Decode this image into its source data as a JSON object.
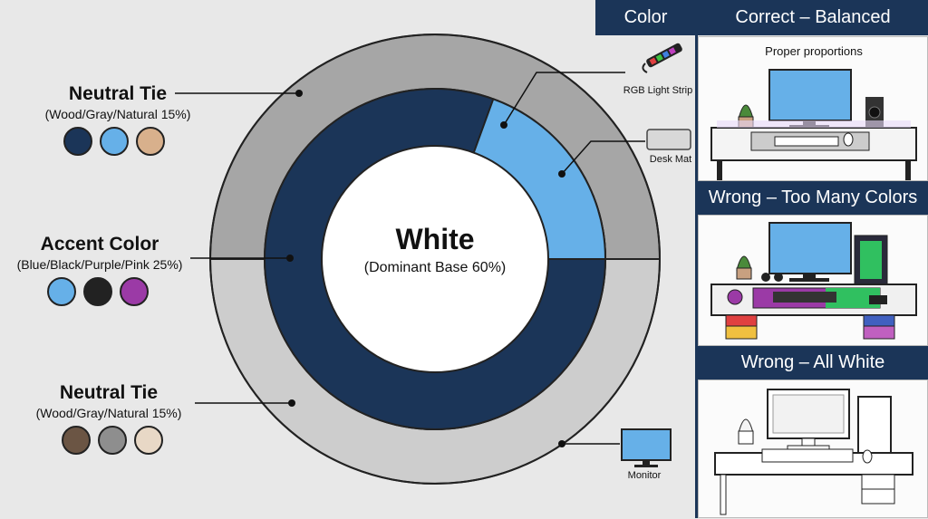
{
  "donut": {
    "center_title": "White",
    "center_subtitle": "(Dominant Base 60%)"
  },
  "labels": {
    "neutral_top": {
      "title": "Neutral Tie",
      "subtitle": "(Wood/Gray/Natural 15%)"
    },
    "accent": {
      "title": "Accent Color",
      "subtitle": "(Blue/Black/Purple/Pink 25%)"
    },
    "neutral_bottom": {
      "title": "Neutral Tie",
      "subtitle": "(Wood/Gray/Natural 15%)"
    }
  },
  "swatches": {
    "neutral_top": [
      "#1b3558",
      "#66b0e8",
      "#d8b08c"
    ],
    "accent": [
      "#66b0e8",
      "#222222",
      "#9b3aa6"
    ],
    "neutral_bottom": [
      "#6b5544",
      "#8e8e8e",
      "#e8d8c6"
    ]
  },
  "callouts": {
    "rgb_strip": "RGB Light Strip",
    "desk_mat": "Desk Mat",
    "monitor": "Monitor"
  },
  "right_panel": {
    "color_header": "Color",
    "correct_header": "Correct – Balanced",
    "correct_caption": "Proper proportions",
    "wrong_colors_header": "Wrong – Too Many Colors",
    "wrong_white_header": "Wrong – All White"
  },
  "colors": {
    "navy": "#1b3558",
    "light_blue": "#66b0e8",
    "gray_outer": "#a6a6a6",
    "gray_light": "#cdcdcd",
    "white": "#ffffff"
  }
}
